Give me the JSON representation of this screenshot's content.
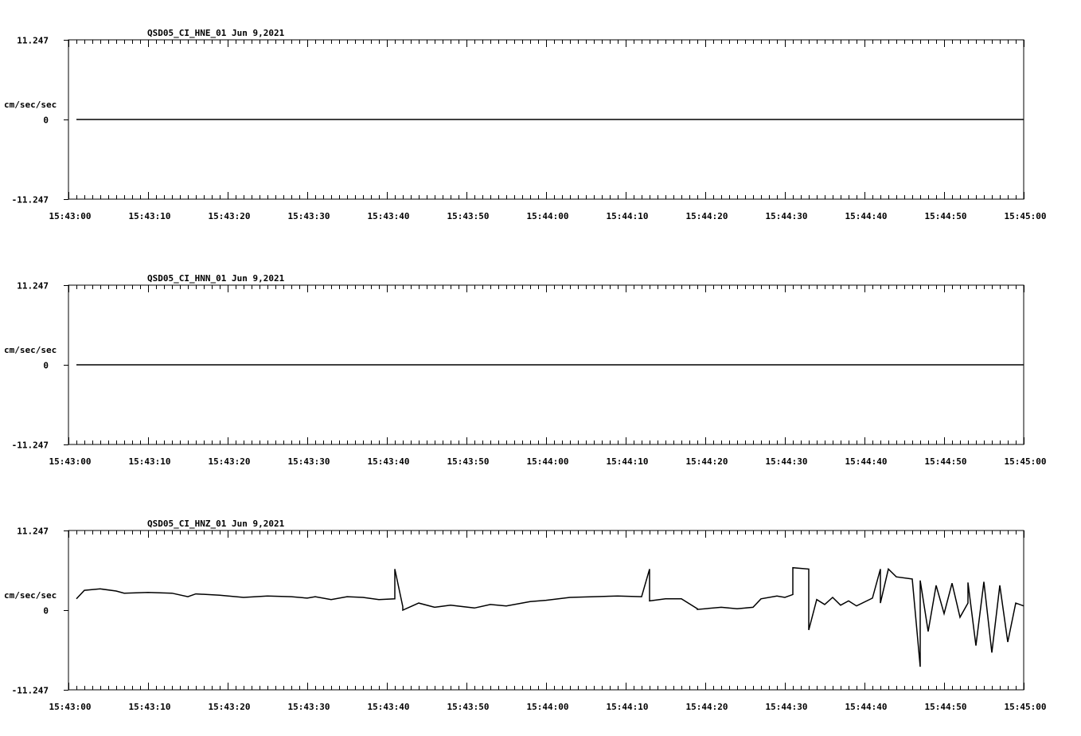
{
  "chart_data": [
    {
      "type": "line",
      "title": "QSD05_CI_HNE_01  Jun 9,2021",
      "ylabel": "cm/sec/sec",
      "ylim": [
        -11.247,
        11.247
      ],
      "y_tick_labels": [
        "11.247",
        "0",
        "-11.247"
      ],
      "xlim": [
        "15:43:00",
        "15:45:00"
      ],
      "x_tick_labels": [
        "15:43:00",
        "15:43:10",
        "15:43:20",
        "15:43:30",
        "15:43:40",
        "15:43:50",
        "15:44:00",
        "15:44:10",
        "15:44:20",
        "15:44:30",
        "15:44:40",
        "15:44:50",
        "15:45:00"
      ],
      "grid": false,
      "series": [
        {
          "x": [
            "15:43:01",
            "15:45:00"
          ],
          "values": [
            0,
            0
          ]
        }
      ]
    },
    {
      "type": "line",
      "title": "QSD05_CI_HNN_01  Jun 9,2021",
      "ylabel": "cm/sec/sec",
      "ylim": [
        -11.247,
        11.247
      ],
      "y_tick_labels": [
        "11.247",
        "0",
        "-11.247"
      ],
      "xlim": [
        "15:43:00",
        "15:45:00"
      ],
      "x_tick_labels": [
        "15:43:00",
        "15:43:10",
        "15:43:20",
        "15:43:30",
        "15:43:40",
        "15:43:50",
        "15:44:00",
        "15:44:10",
        "15:44:20",
        "15:44:30",
        "15:44:40",
        "15:44:50",
        "15:45:00"
      ],
      "grid": false,
      "series": [
        {
          "x": [
            "15:43:01",
            "15:45:00"
          ],
          "values": [
            0,
            0
          ]
        }
      ]
    },
    {
      "type": "line",
      "title": "QSD05_CI_HNZ_01  Jun 9,2021",
      "ylabel": "cm/sec/sec",
      "ylim": [
        -11.247,
        11.247
      ],
      "y_tick_labels": [
        "11.247",
        "0",
        "-11.247"
      ],
      "xlim": [
        "15:43:00",
        "15:45:00"
      ],
      "x_tick_labels": [
        "15:43:00",
        "15:43:10",
        "15:43:20",
        "15:43:30",
        "15:43:40",
        "15:43:50",
        "15:44:00",
        "15:44:10",
        "15:44:20",
        "15:44:30",
        "15:44:40",
        "15:44:50",
        "15:45:00"
      ],
      "grid": false,
      "series": [
        {
          "x": [
            "15:43:01",
            "15:43:02",
            "15:43:04",
            "15:43:06",
            "15:43:07",
            "15:43:10",
            "15:43:13",
            "15:43:15",
            "15:43:16",
            "15:43:19",
            "15:43:22",
            "15:43:25",
            "15:43:28",
            "15:43:30",
            "15:43:31",
            "15:43:33",
            "15:43:35",
            "15:43:37",
            "15:43:39",
            "15:43:41",
            "15:43:41",
            "15:43:42",
            "15:43:42",
            "15:43:44",
            "15:43:46",
            "15:43:48",
            "15:43:51",
            "15:43:53",
            "15:43:55",
            "15:43:58",
            "15:44:00",
            "15:44:03",
            "15:44:06",
            "15:44:09",
            "15:44:12",
            "15:44:13",
            "15:44:13",
            "15:44:15",
            "15:44:17",
            "15:44:19",
            "15:44:19",
            "15:44:22",
            "15:44:24",
            "15:44:26",
            "15:44:27",
            "15:44:29",
            "15:44:30",
            "15:44:31",
            "15:44:31",
            "15:44:33",
            "15:44:33",
            "15:44:34",
            "15:44:35",
            "15:44:36",
            "15:44:37",
            "15:44:38",
            "15:44:39",
            "15:44:41",
            "15:44:42",
            "15:44:42",
            "15:44:43",
            "15:44:44",
            "15:44:46",
            "15:44:47",
            "15:44:47",
            "15:44:48",
            "15:44:49",
            "15:44:50",
            "15:44:51",
            "15:44:52",
            "15:44:53",
            "15:44:53",
            "15:44:54",
            "15:44:55",
            "15:44:56",
            "15:44:57",
            "15:44:58",
            "15:44:59",
            "15:45:00"
          ],
          "values": [
            1.6,
            2.8,
            3.0,
            2.7,
            2.4,
            2.5,
            2.4,
            1.9,
            2.3,
            2.1,
            1.8,
            2.0,
            1.9,
            1.7,
            1.9,
            1.5,
            1.9,
            1.8,
            1.5,
            1.6,
            5.8,
            0.5,
            0.0,
            1.0,
            0.4,
            0.7,
            0.3,
            0.8,
            0.6,
            1.2,
            1.4,
            1.8,
            1.9,
            2.0,
            1.9,
            5.8,
            1.3,
            1.6,
            1.6,
            0.2,
            0.1,
            0.4,
            0.2,
            0.4,
            1.6,
            2.0,
            1.8,
            2.2,
            6.0,
            5.8,
            -2.8,
            1.5,
            0.8,
            1.8,
            0.7,
            1.3,
            0.6,
            1.7,
            5.8,
            1.0,
            5.8,
            4.7,
            4.4,
            -8.0,
            4.2,
            -3.0,
            3.5,
            -0.5,
            3.8,
            -1.0,
            1.0,
            3.9,
            -5.0,
            4.0,
            -6.0,
            3.5,
            -4.5,
            1.0,
            0.6
          ]
        }
      ]
    }
  ]
}
